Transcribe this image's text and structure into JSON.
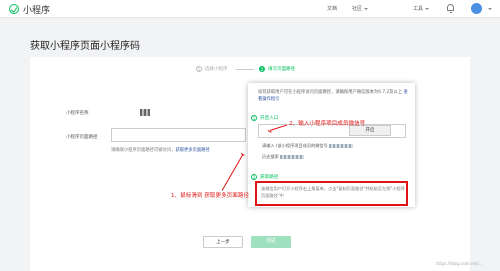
{
  "app": {
    "title": "小程序"
  },
  "nav": {
    "docs": "文档",
    "community": "社区",
    "tools": "工具"
  },
  "page": {
    "title": "获取小程序页面小程序码"
  },
  "steps": [
    {
      "num": "1",
      "label": "选择小程序"
    },
    {
      "num": "2",
      "label": "填写页面路径"
    }
  ],
  "form": {
    "name_label": "小程序名称",
    "name_value": "",
    "path_label": "小程序页面路径",
    "path_value": "",
    "hint_text": "请确保小程序页面路径可被访问，",
    "hint_link": "获取更多页面路径"
  },
  "buttons": {
    "prev": "上一步",
    "done": "完成"
  },
  "popover": {
    "desc_text": "如何获取用户可在小程序访问页面路径，请确保用户微信版本为6.7.2及以上",
    "desc_link": "查看操作指引",
    "section1": {
      "num": "1",
      "title": "开启入口"
    },
    "open_button": "开启",
    "line1": "请输入 (该小程序项目成员的微信号",
    "line2": "历史搜索",
    "section2": {
      "num": "2",
      "title": "获取路径"
    },
    "boxed_text": "该微信用户打开小程序右上角菜单，点击\"复制页面路径\"并粘贴至左侧\"小程序页面路径\"中"
  },
  "annotations": {
    "step1": "1、鼠标滑到 获取更多页面路径",
    "step2": "2、输入小程序项目成员微信号"
  },
  "watermark": "https://blog.csdn.net/..."
}
